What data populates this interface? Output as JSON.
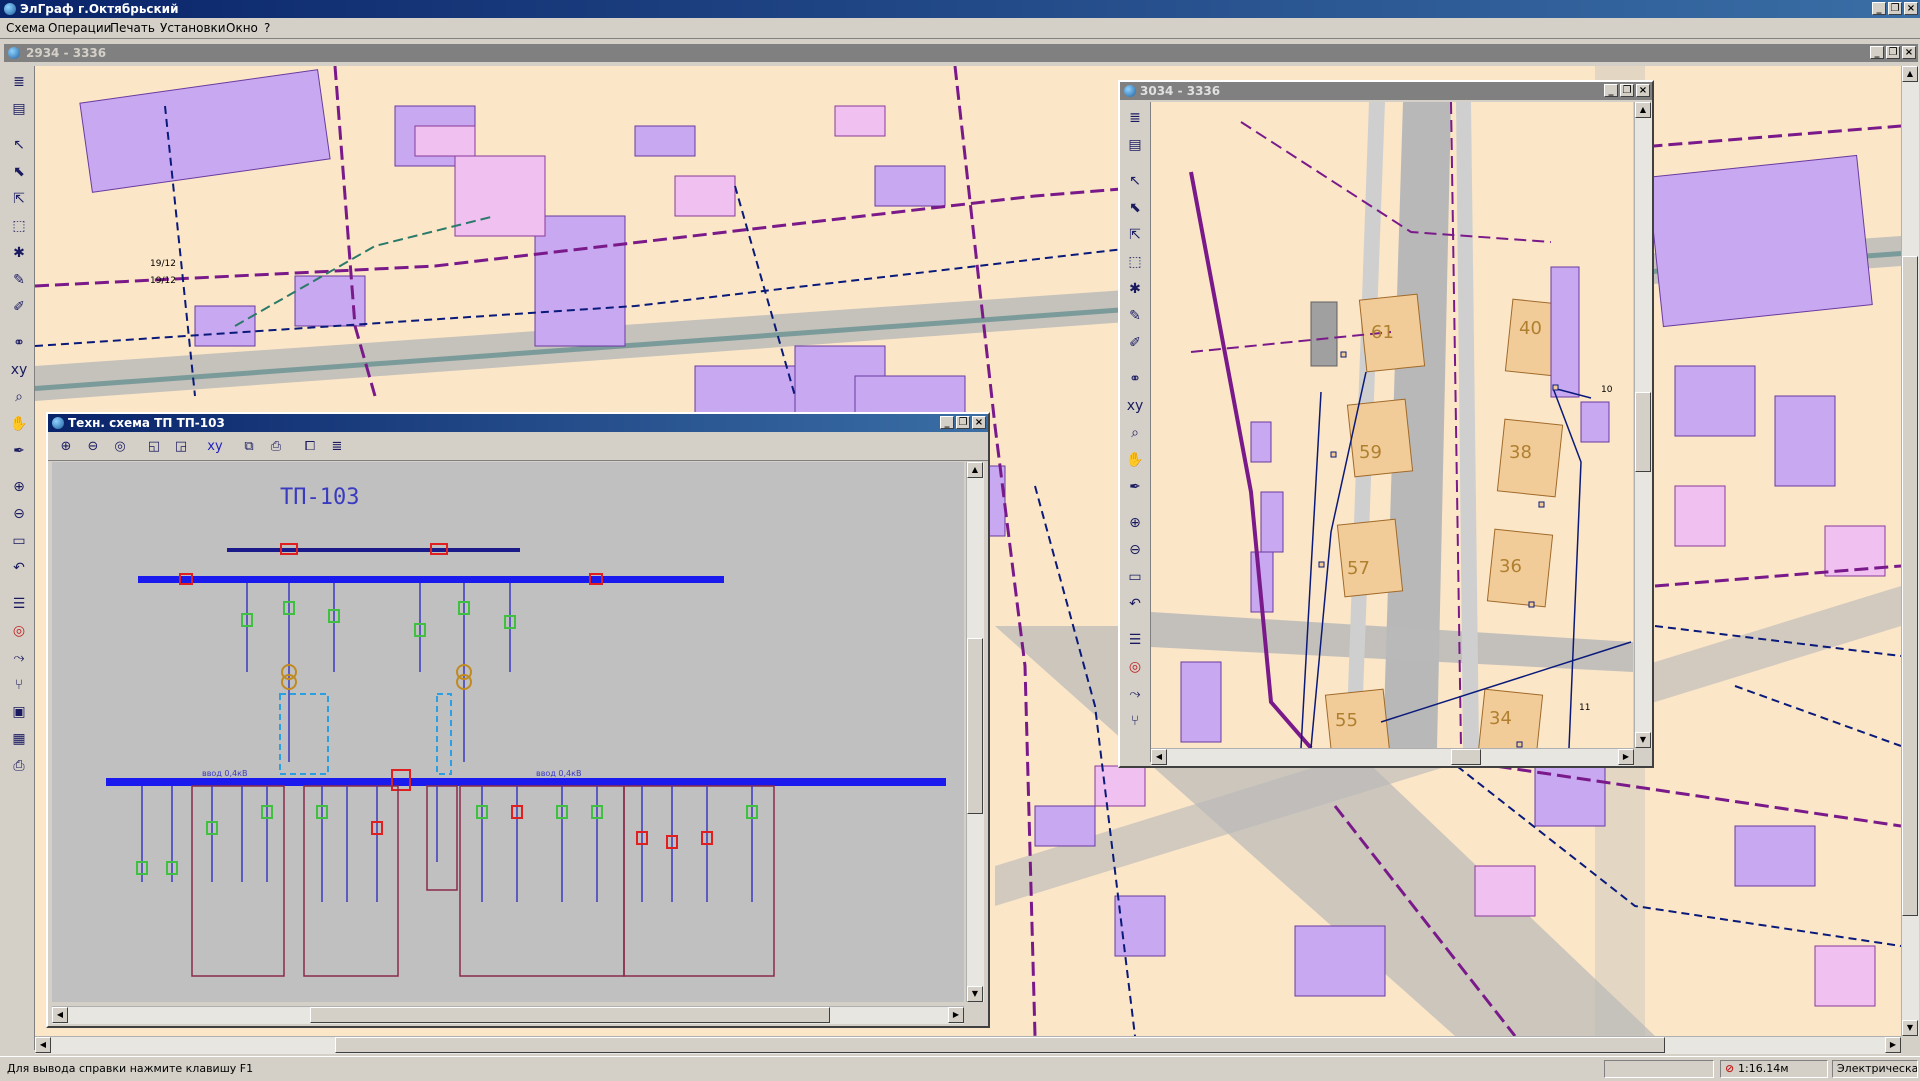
{
  "app": {
    "title": "ЭлГраф г.Октябрьский"
  },
  "menu": [
    "Схема",
    "Операции",
    "Печать",
    "Установки",
    "Окно",
    "?"
  ],
  "map_window": {
    "title": "2934 - 3336",
    "labels": [
      "19/12",
      "19/12"
    ]
  },
  "schema_window": {
    "title": "Техн. схема ТП ТП-103",
    "heading": "ТП-103",
    "toolbar_icons": [
      "zoom-in-icon",
      "zoom-out-icon",
      "target-icon",
      "layers-back-icon",
      "layers-front-icon",
      "xy-icon",
      "copy-icon",
      "print-icon",
      "preview-icon",
      "layers-icon"
    ],
    "bus_labels": [
      "ввод 0,4кВ",
      "ввод 0,4кВ"
    ]
  },
  "mini_window": {
    "title": "3034 - 3336",
    "buildings": [
      "61",
      "59",
      "57",
      "55",
      "40",
      "38",
      "36",
      "34"
    ],
    "numbers": [
      "10",
      "11"
    ]
  },
  "left_toolbar_icons": [
    "layers-icon",
    "page-icon",
    "pointer-icon",
    "select-icon",
    "select-node-icon",
    "select-area-icon",
    "select-red-icon",
    "pencil-icon",
    "edit-icon",
    "binoculars-icon",
    "xy-icon",
    "search-icon",
    "hand-icon",
    "pen-icon",
    "zoom-in-icon",
    "zoom-out-icon",
    "fit-icon",
    "undo-icon",
    "stack-icon",
    "target-icon",
    "route-icon",
    "branch-icon",
    "image-icon",
    "table-icon",
    "print-icon"
  ],
  "status": {
    "help": "Для вывода справки нажмите клавишу F1",
    "scale": "1:16.14м",
    "layer": "Электрическая се"
  },
  "colors": {
    "map_bg": "#fbe6c8",
    "building": "#c8a8f0",
    "building_light": "#f0c0f0",
    "road": "#b8b8b8",
    "line_purple": "#7a1a8a",
    "line_navy": "#0a1a7a",
    "bus_blue": "#1a1aee",
    "switch_green": "#40c040",
    "switch_red": "#e02020",
    "schema_text": "#3a3ac0"
  }
}
